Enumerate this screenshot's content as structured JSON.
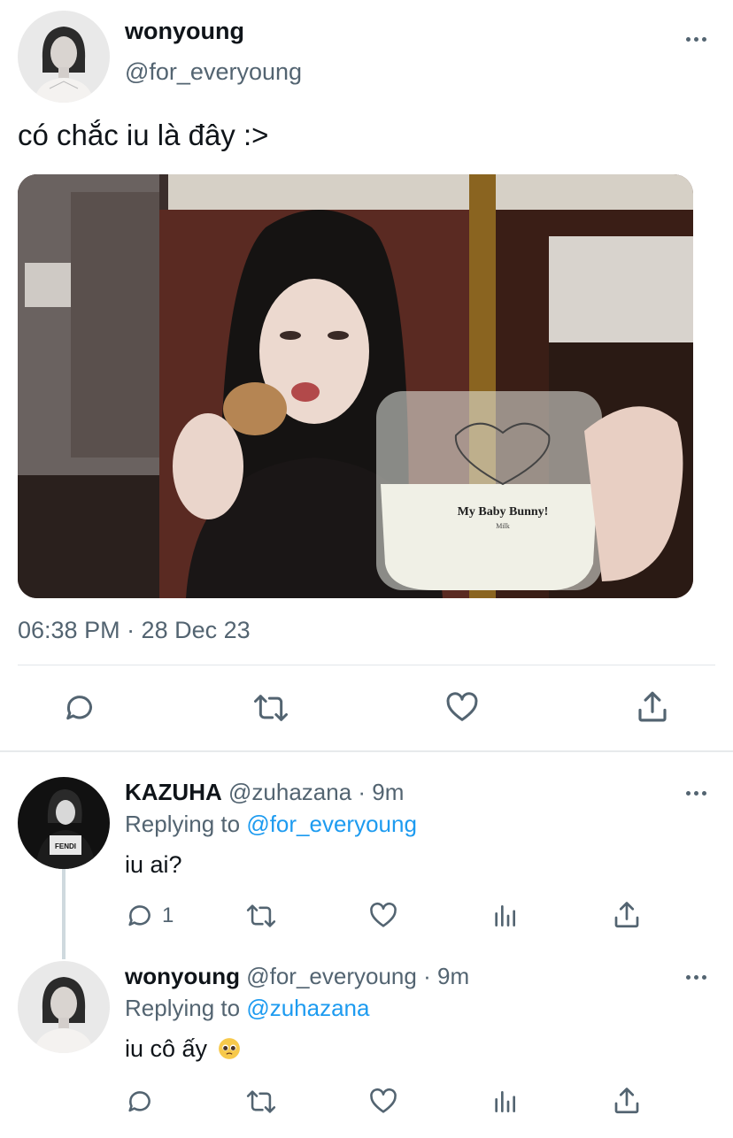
{
  "tweet": {
    "author_name": "wonyoung",
    "author_handle": "@for_everyoung",
    "text": "có chắc iu là đây :>",
    "timestamp": "06:38 PM · 28 Dec 23",
    "photo": {
      "mug_text": "My Baby Bunny!",
      "mug_subtext": "Milk"
    },
    "actions": [
      "reply-icon",
      "retweet-icon",
      "like-icon",
      "share-icon"
    ]
  },
  "replies": [
    {
      "author_name": "KAZUHA",
      "author_handle": "@zuhazana",
      "separator": "·",
      "time": "9m",
      "replying_label": "Replying to",
      "replying_handle": "@for_everyoung",
      "text": "iu ai?",
      "reply_count": "1",
      "avatar_text": "FENDI"
    },
    {
      "author_name": "wonyoung",
      "author_handle": "@for_everyoung",
      "separator": "·",
      "time": "9m",
      "replying_label": "Replying to",
      "replying_handle": "@zuhazana",
      "text": "iu cô ấy",
      "emoji": "pleading-face-emoji"
    }
  ],
  "colors": {
    "text_primary": "#0f1419",
    "text_secondary": "#536471",
    "link": "#1d9bf0",
    "divider": "#e1e6ea"
  }
}
